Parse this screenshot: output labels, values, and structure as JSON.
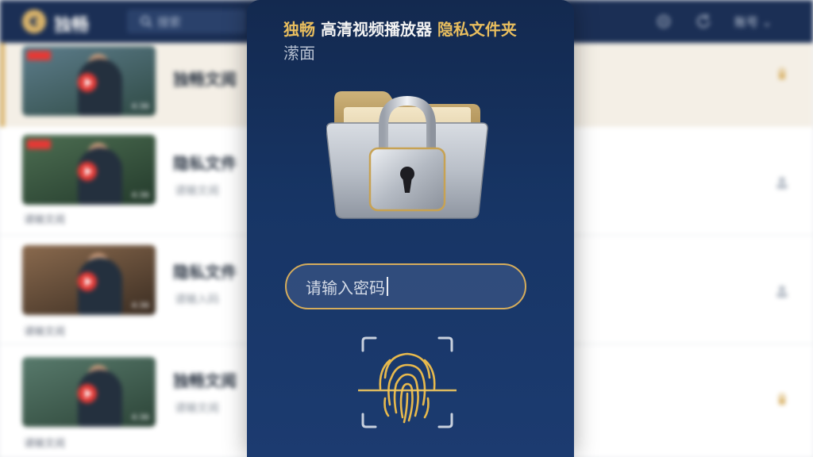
{
  "app": {
    "logo_glyph": "€",
    "name": "独畅",
    "search_placeholder": "搜索",
    "user_label": "账号"
  },
  "list": [
    {
      "title": "独畅文阅",
      "subtitle": "",
      "label": "",
      "duration": "4:36",
      "active": true
    },
    {
      "title": "隐私文件",
      "subtitle": "请输文阅",
      "label": "请输文阅",
      "duration": "4:36",
      "active": false
    },
    {
      "title": "隐私文件",
      "subtitle": "请输入码",
      "label": "请输文阅",
      "duration": "4:36",
      "active": false
    },
    {
      "title": "独畅文阅",
      "subtitle": "请输文阅",
      "label": "请输文阅",
      "duration": "4:36",
      "active": false
    }
  ],
  "modal": {
    "title_brand": "独畅",
    "title_main": " 高清视频播放器 ",
    "title_feature": "隐私文件夹",
    "title_extra": "潆面",
    "password_placeholder": "请输入密码"
  },
  "colors": {
    "accent_gold": "#e9be5e",
    "modal_bg": "#173565",
    "topbar_bg": "#1b2f55"
  }
}
